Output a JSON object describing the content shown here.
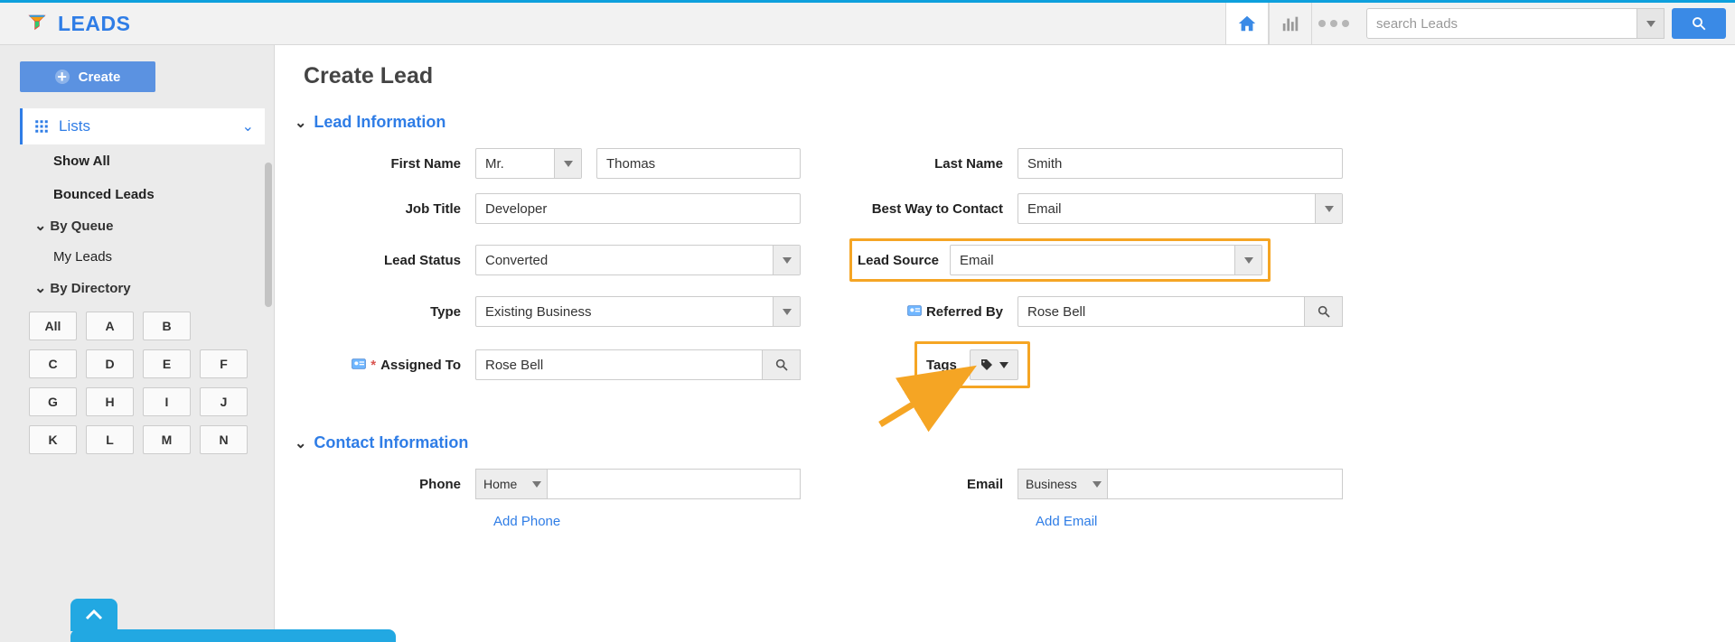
{
  "app_title": "LEADS",
  "search_placeholder": "search Leads",
  "sidebar": {
    "create_label": "Create",
    "lists_label": "Lists",
    "show_all": "Show All",
    "bounced": "Bounced Leads",
    "by_queue": "By Queue",
    "my_leads": "My Leads",
    "by_directory": "By Directory",
    "directory": [
      "All",
      "A",
      "B",
      "C",
      "D",
      "E",
      "F",
      "G",
      "H",
      "I",
      "J",
      "K",
      "L",
      "M",
      "N"
    ]
  },
  "page_title": "Create Lead",
  "sections": {
    "lead_info": "Lead Information",
    "contact_info": "Contact Information"
  },
  "labels": {
    "first_name": "First Name",
    "last_name": "Last Name",
    "job_title": "Job Title",
    "best_contact": "Best Way to Contact",
    "lead_status": "Lead Status",
    "lead_source": "Lead Source",
    "type": "Type",
    "referred_by": "Referred By",
    "assigned_to": "Assigned To",
    "tags": "Tags",
    "phone": "Phone",
    "email": "Email",
    "add_phone": "Add Phone",
    "add_email": "Add Email"
  },
  "values": {
    "salutation": "Mr.",
    "first_name": "Thomas",
    "last_name": "Smith",
    "job_title": "Developer",
    "best_contact": "Email",
    "lead_status": "Converted",
    "lead_source": "Email",
    "type": "Existing Business",
    "referred_by": "Rose Bell",
    "assigned_to": "Rose Bell",
    "phone_type": "Home",
    "email_type": "Business"
  }
}
